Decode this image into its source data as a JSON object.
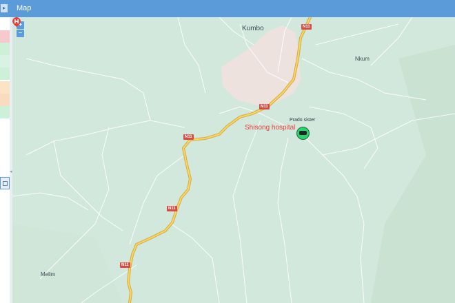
{
  "header": {
    "title": "Map"
  },
  "left_panel": {
    "collapse_arrow": "◂",
    "expand_arrow": "▸"
  },
  "map": {
    "zoom_in": "+",
    "zoom_out": "−",
    "places": {
      "kumbo": "Kumbo",
      "nkum": "Nkum",
      "melim": "Melim"
    },
    "road_shields": [
      "N11",
      "N11",
      "N11",
      "N11",
      "N11"
    ],
    "poi": {
      "hospital": "Shisong hospital",
      "vehicle_label": "Prado sister"
    },
    "colors": {
      "land": "#d3e8dc",
      "urban": "#ede2de",
      "highway": "#f2c94c",
      "shield": "#d94a43",
      "accent": "#5b9bd9",
      "marker": "#2fd06d"
    }
  }
}
